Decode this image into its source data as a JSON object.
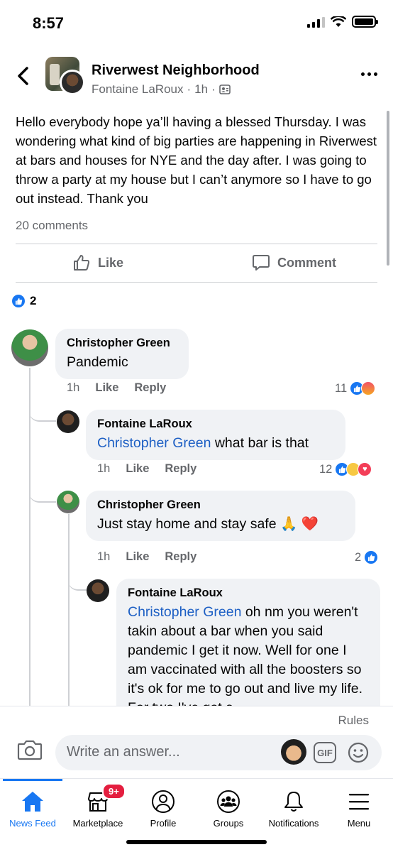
{
  "status_bar": {
    "time": "8:57"
  },
  "header": {
    "group_name": "Riverwest Neighborhood",
    "author": "Fontaine LaRoux",
    "time": "1h"
  },
  "post": {
    "text": "Hello everybody hope ya’ll having a blessed Thursday. I was wondering what kind of big parties are happening in Riverwest at bars and houses for NYE and the day after. I was going to throw a party at my house but I can’t anymore so I have to go out instead. Thank you",
    "comment_count": "20 comments",
    "like_label": "Like",
    "comment_label": "Comment",
    "reaction_count": "2"
  },
  "comments": [
    {
      "author": "Christopher Green",
      "text": "Pandemic",
      "time": "1h",
      "like": "Like",
      "reply": "Reply",
      "reaction_count": "11"
    },
    {
      "author": "Fontaine LaRoux",
      "mention": "Christopher Green",
      "text": " what bar is that",
      "time": "1h",
      "like": "Like",
      "reply": "Reply",
      "reaction_count": "12"
    },
    {
      "author": "Christopher Green",
      "text": "Just stay home and stay safe 🙏 ❤️",
      "time": "1h",
      "like": "Like",
      "reply": "Reply",
      "reaction_count": "2"
    },
    {
      "author": "Fontaine LaRoux",
      "mention": "Christopher Green",
      "text": " oh nm you weren't takin about a bar when you said pandemic I get it now. Well for one I am vaccinated with all the boosters so it's ok for me to go out and live my life. For two I've got a"
    }
  ],
  "composer": {
    "rules": "Rules",
    "placeholder": "Write an answer...",
    "gif_label": "GIF"
  },
  "tabs": [
    {
      "label": "News Feed",
      "icon": "home-icon",
      "active": true
    },
    {
      "label": "Marketplace",
      "icon": "marketplace-icon",
      "badge": "9+"
    },
    {
      "label": "Profile",
      "icon": "profile-icon"
    },
    {
      "label": "Groups",
      "icon": "groups-icon"
    },
    {
      "label": "Notifications",
      "icon": "bell-icon"
    },
    {
      "label": "Menu",
      "icon": "menu-icon"
    }
  ],
  "colors": {
    "accent": "#1877f2",
    "mention": "#1d5fc4",
    "secondary_text": "#65676b",
    "bubble_bg": "#f0f2f5",
    "badge": "#e41e3f"
  }
}
